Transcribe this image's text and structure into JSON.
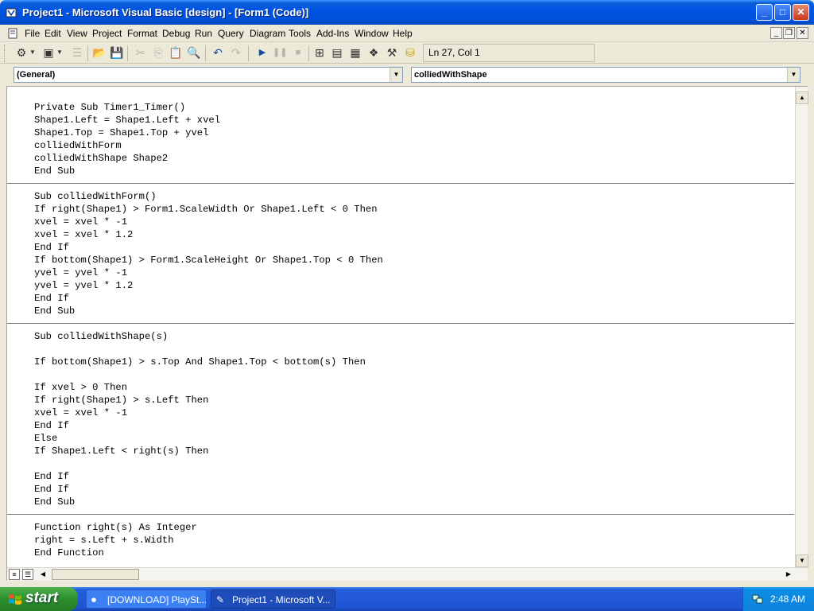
{
  "window": {
    "title": "Project1 - Microsoft Visual Basic [design] - [Form1 (Code)]"
  },
  "menu": [
    "File",
    "Edit",
    "View",
    "Project",
    "Format",
    "Debug",
    "Run",
    "Query",
    "Diagram",
    "Tools",
    "Add-Ins",
    "Window",
    "Help"
  ],
  "toolbar": {
    "status": "Ln 27, Col 1"
  },
  "combos": {
    "object": "(General)",
    "procedure": "colliedWithShape"
  },
  "code": {
    "procedures": [
      [
        "Private Sub Timer1_Timer()",
        "Shape1.Left = Shape1.Left + xvel",
        "Shape1.Top = Shape1.Top + yvel",
        "colliedWithForm",
        "colliedWithShape Shape2",
        "End Sub"
      ],
      [
        "Sub colliedWithForm()",
        "If right(Shape1) > Form1.ScaleWidth Or Shape1.Left < 0 Then",
        "xvel = xvel * -1",
        "xvel = xvel * 1.2",
        "End If",
        "If bottom(Shape1) > Form1.ScaleHeight Or Shape1.Top < 0 Then",
        "yvel = yvel * -1",
        "yvel = yvel * 1.2",
        "End If",
        "End Sub"
      ],
      [
        "Sub colliedWithShape(s)",
        "",
        "If bottom(Shape1) > s.Top And Shape1.Top < bottom(s) Then",
        "",
        "If xvel > 0 Then",
        "If right(Shape1) > s.Left Then",
        "xvel = xvel * -1",
        "End If",
        "Else",
        "If Shape1.Left < right(s) Then",
        "",
        "End If",
        "End If",
        "End Sub"
      ],
      [
        "Function right(s) As Integer",
        "right = s.Left + s.Width",
        "End Function"
      ]
    ]
  },
  "taskbar": {
    "start_label": "start",
    "tasks": [
      "[DOWNLOAD] PlaySt...",
      "Project1 - Microsoft V..."
    ],
    "clock": "2:48 AM"
  },
  "colors": {
    "titlebar": "#0054e3",
    "keyword": "#00008b",
    "taskbar": "#245edb",
    "start_button": "#2e8f2e"
  }
}
